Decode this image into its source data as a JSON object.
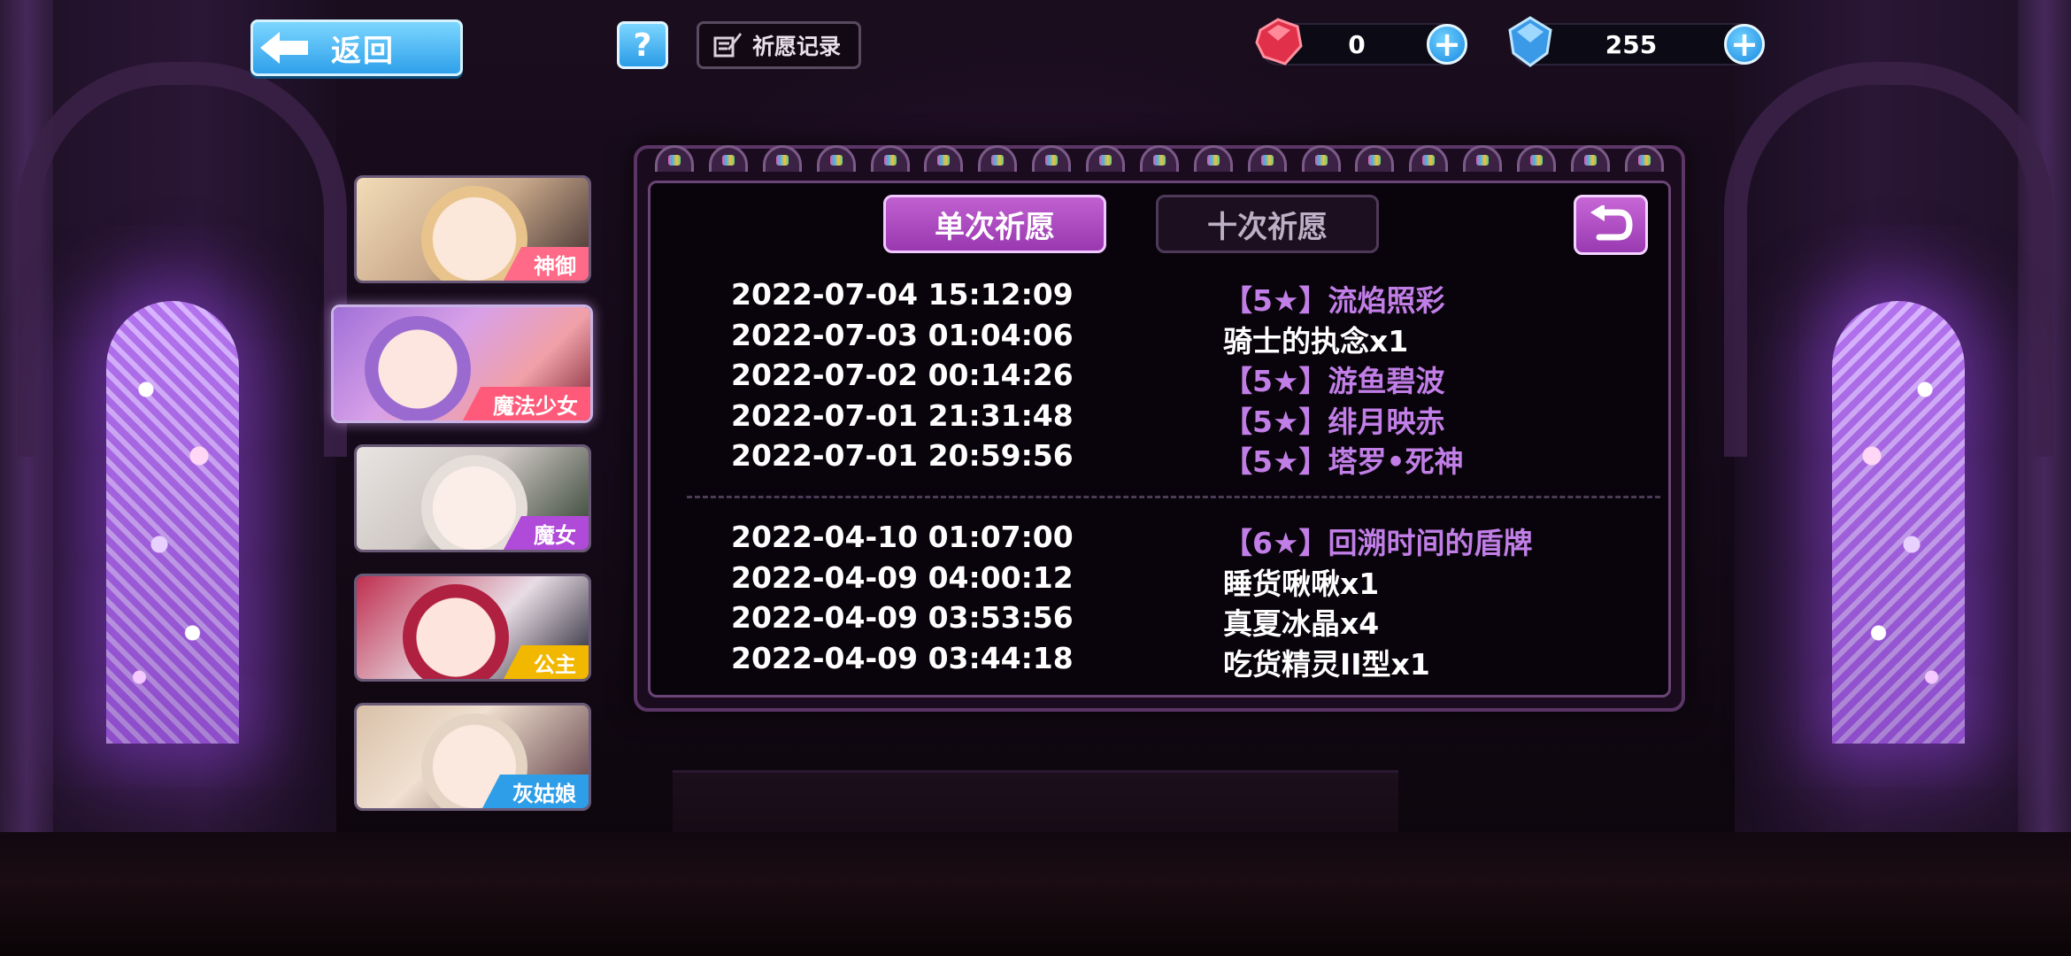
{
  "topbar": {
    "back_label": "返回",
    "help_label": "?",
    "records_label": "祈愿记录"
  },
  "currencies": [
    {
      "icon": "red-gem-icon",
      "value": "0",
      "color": "#e0304a"
    },
    {
      "icon": "blue-crystal-icon",
      "value": "255",
      "color": "#3a9ae8"
    }
  ],
  "categories": [
    {
      "label": "神御",
      "color": "#ff6a88",
      "active": false
    },
    {
      "label": "魔法少女",
      "color": "#ff5a7a",
      "active": true
    },
    {
      "label": "魔女",
      "color": "#b04ad8",
      "active": false
    },
    {
      "label": "公主",
      "color": "#f2b800",
      "active": false
    },
    {
      "label": "灰姑娘",
      "color": "#2f9ee8",
      "active": false
    }
  ],
  "tabs": {
    "single": "单次祈愿",
    "ten": "十次祈愿"
  },
  "records": {
    "group1": [
      {
        "time": "2022-07-04 15:12:09",
        "item": "【5★】流焰照彩",
        "rare": true
      },
      {
        "time": "2022-07-03 01:04:06",
        "item": "骑士的执念x1",
        "rare": false
      },
      {
        "time": "2022-07-02 00:14:26",
        "item": "【5★】游鱼碧波",
        "rare": true
      },
      {
        "time": "2022-07-01 21:31:48",
        "item": "【5★】绯月映赤",
        "rare": true
      },
      {
        "time": "2022-07-01 20:59:56",
        "item": "【5★】塔罗•死神",
        "rare": true
      }
    ],
    "group2": [
      {
        "time": "2022-04-10 01:07:00",
        "item": "【6★】回溯时间的盾牌",
        "rare": true
      },
      {
        "time": "2022-04-09 04:00:12",
        "item": "睡货啾啾x1",
        "rare": false
      },
      {
        "time": "2022-04-09 03:53:56",
        "item": "真夏冰晶x4",
        "rare": false
      },
      {
        "time": "2022-04-09 03:44:18",
        "item": "吃货精灵II型x1",
        "rare": false
      }
    ]
  },
  "colors": {
    "accent_purple": "#b04ac8",
    "rare_text": "#c07ee6",
    "button_blue": "#2ea0ea"
  }
}
